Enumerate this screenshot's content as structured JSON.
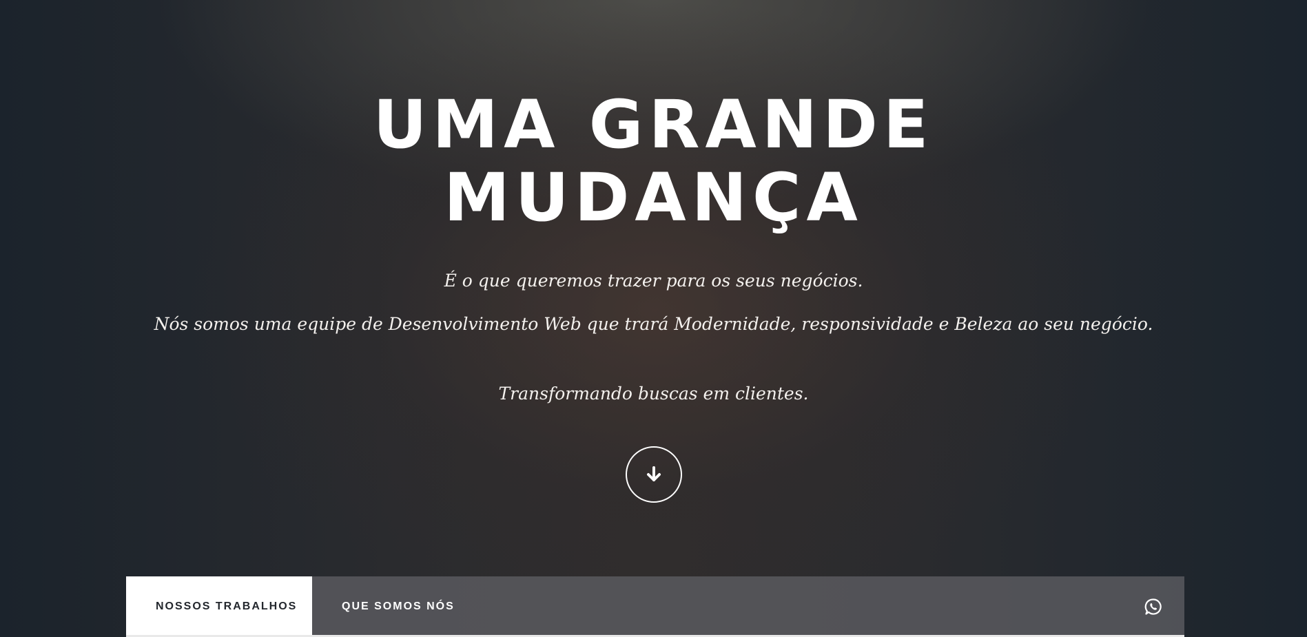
{
  "hero": {
    "headline_line1": "UMA GRANDE",
    "headline_line2": "MUDANÇA",
    "tagline": "É o que queremos trazer para os seus negócios.",
    "description": "Nós somos uma equipe de Desenvolvimento Web que trará Modernidade, responsividade e Beleza ao seu negócio.",
    "slogan": "Transformando buscas em clientes.",
    "scroll_icon": "arrow-down-icon"
  },
  "nav": {
    "tab_work": "NOSSOS TRABALHOS",
    "tab_about": "QUE SOMOS NÓS",
    "whatsapp_icon": "whatsapp-icon",
    "active_tab_bg": "#ffffff",
    "active_tab_text": "#23272d"
  }
}
